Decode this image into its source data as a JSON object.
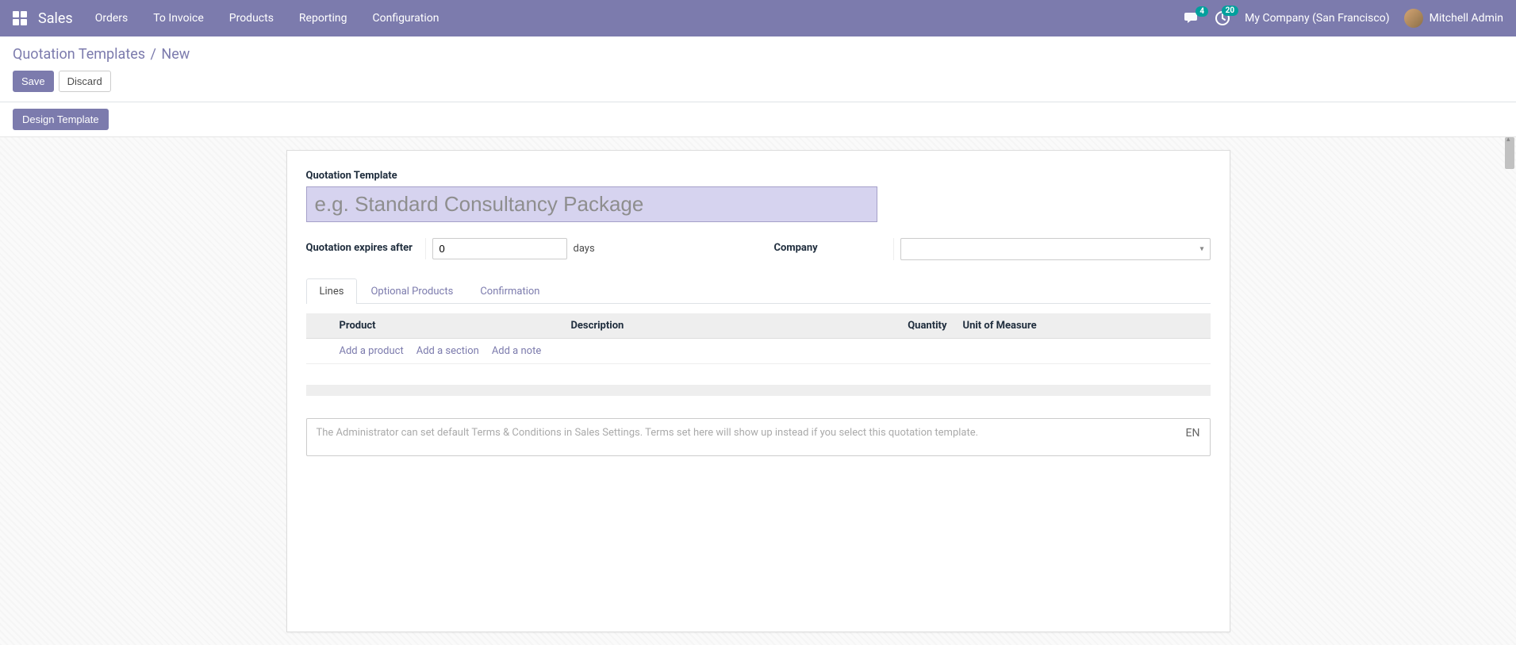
{
  "navbar": {
    "brand": "Sales",
    "menu": [
      "Orders",
      "To Invoice",
      "Products",
      "Reporting",
      "Configuration"
    ],
    "messages_badge": "4",
    "activities_badge": "20",
    "company": "My Company (San Francisco)",
    "user_name": "Mitchell Admin"
  },
  "breadcrumb": {
    "parent": "Quotation Templates",
    "current": "New"
  },
  "buttons": {
    "save": "Save",
    "discard": "Discard",
    "design_template": "Design Template"
  },
  "form": {
    "title_label": "Quotation Template",
    "title_placeholder": "e.g. Standard Consultancy Package",
    "title_value": "",
    "expires_label": "Quotation expires after",
    "expires_value": "0",
    "expires_unit": "days",
    "company_label": "Company",
    "company_value": ""
  },
  "tabs": [
    "Lines",
    "Optional Products",
    "Confirmation"
  ],
  "table": {
    "headers": {
      "product": "Product",
      "description": "Description",
      "quantity": "Quantity",
      "uom": "Unit of Measure"
    },
    "actions": {
      "add_product": "Add a product",
      "add_section": "Add a section",
      "add_note": "Add a note"
    }
  },
  "terms": {
    "placeholder": "The Administrator can set default Terms & Conditions in Sales Settings. Terms set here will show up instead if you select this quotation template.",
    "lang": "EN"
  }
}
